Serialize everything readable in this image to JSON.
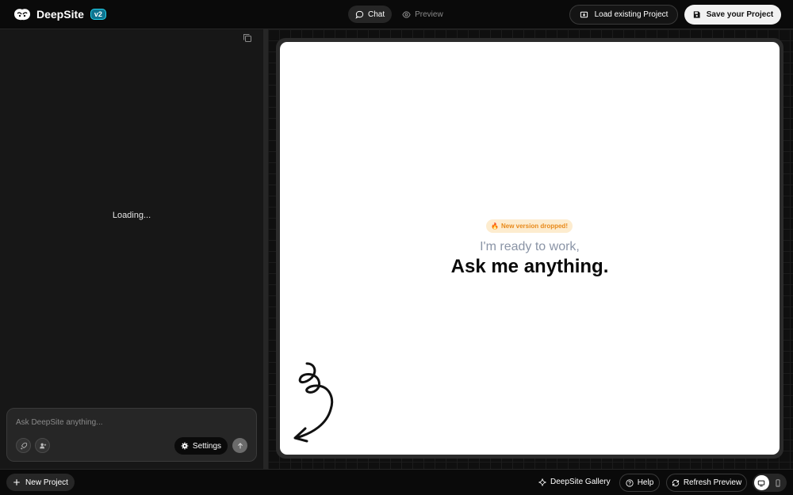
{
  "header": {
    "brand_name": "DeepSite",
    "brand_badge": "v2",
    "tabs": [
      {
        "label": "Chat",
        "active": true,
        "icon": "chat-bubble-icon"
      },
      {
        "label": "Preview",
        "active": false,
        "icon": "eye-icon"
      }
    ],
    "load_button": "Load existing Project",
    "save_button": "Save your Project"
  },
  "left_panel": {
    "loading_text": "Loading...",
    "chat": {
      "placeholder": "Ask DeepSite anything...",
      "settings_label": "Settings"
    }
  },
  "preview": {
    "badge": "New version dropped!",
    "ready_text": "I'm ready to work,",
    "ask_text": "Ask me anything."
  },
  "footer": {
    "new_project": "New Project",
    "gallery": "DeepSite Gallery",
    "help": "Help",
    "refresh": "Refresh Preview"
  },
  "colors": {
    "accent_badge": "#0e7490",
    "new_version_text": "#e8891a",
    "new_version_bg": "#fdeccf"
  }
}
